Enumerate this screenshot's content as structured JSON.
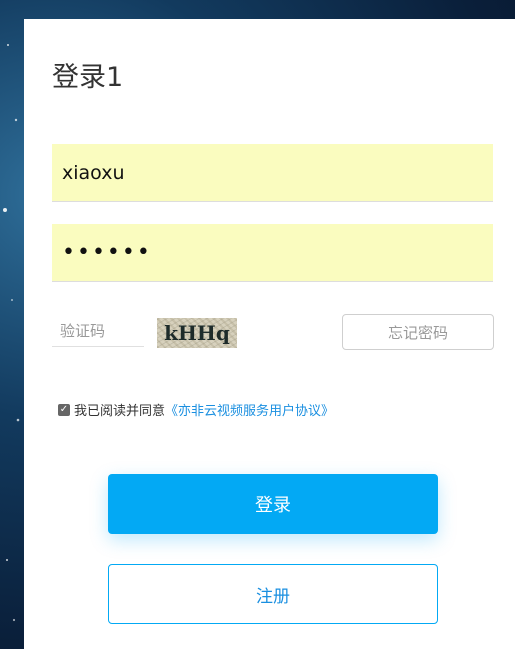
{
  "login": {
    "title": "登录1",
    "username_value": "xiaoxu",
    "password_value": "••••••",
    "captcha_placeholder": "验证码",
    "captcha_text": "kHHq",
    "forgot_label": "忘记密码",
    "agree_checked": true,
    "agree_text": "我已阅读并同意",
    "agree_link": "《亦非云视频服务用户协议》",
    "login_label": "登录",
    "register_label": "注册"
  },
  "colors": {
    "accent": "#03a9f4",
    "field_bg": "#fafcbf",
    "link": "#1a8fe0"
  }
}
